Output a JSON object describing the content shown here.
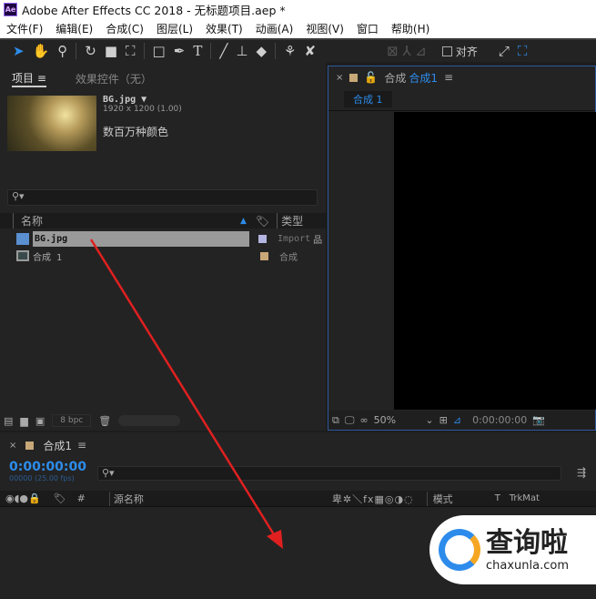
{
  "window": {
    "logo": "Ae",
    "title": "Adobe After Effects CC 2018 - 无标题项目.aep *"
  },
  "menu": [
    "文件(F)",
    "编辑(E)",
    "合成(C)",
    "图层(L)",
    "效果(T)",
    "动画(A)",
    "视图(V)",
    "窗口",
    "帮助(H)"
  ],
  "toolbar": {
    "align_label": "对齐"
  },
  "project": {
    "tab_project": "项目",
    "tab_effects": "效果控件（无）",
    "selected": {
      "name": "BG.jpg",
      "dims": "1920 x 1200 (1.00)",
      "colors": "数百万种颜色"
    },
    "columns": {
      "name": "名称",
      "type": "类型"
    },
    "items": [
      {
        "name": "BG.jpg",
        "type": "Import",
        "color": "#b4b4e0"
      },
      {
        "name": "合成 1",
        "type": "合成",
        "color": "#c8a878"
      }
    ],
    "bpc": "8 bpc"
  },
  "viewer": {
    "tab_label": "合成",
    "comp_name": "合成1",
    "subtab": "合成 1",
    "zoom": "50%",
    "timecode": "0:00:00:00"
  },
  "timeline": {
    "tab": "合成1",
    "timecode": "0:00:00:00",
    "frames": "00000 (25.00 fps)",
    "col_hash": "#",
    "col_source": "源名称",
    "col_mode": "模式",
    "col_t": "T",
    "col_trkmat": "TrkMat"
  },
  "watermark": {
    "text": "查询啦",
    "url": "chaxunla.com"
  },
  "colors": {
    "accent": "#2d8ceb",
    "arrow": "#e02020"
  }
}
